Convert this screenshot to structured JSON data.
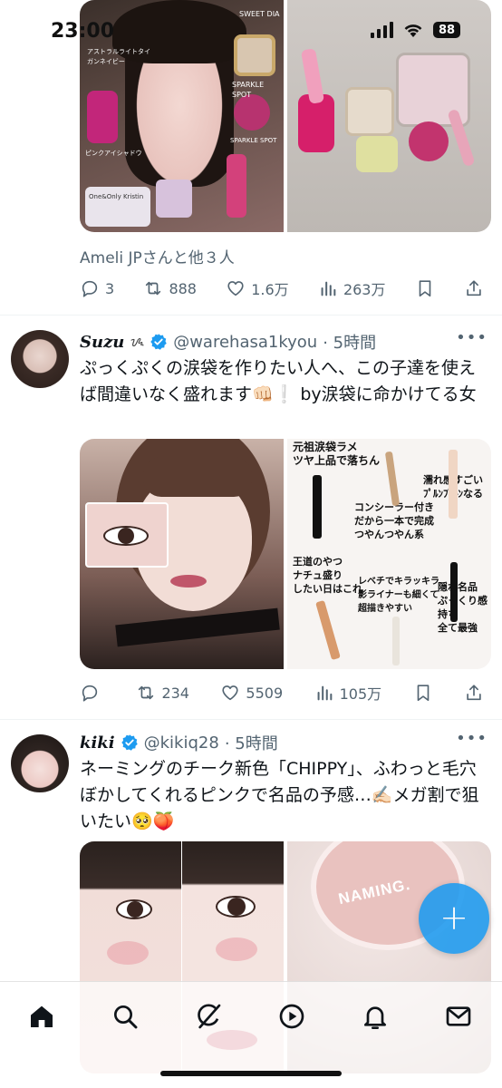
{
  "status_bar": {
    "time": "23:00",
    "battery": "88"
  },
  "tweet1": {
    "social_context": "Ameli JPさんと他３人",
    "image_left_overlays": {
      "label1": "SWEET DIA",
      "label2": "SPARKLE SPOT",
      "label3": "アストラルライトタイガンネイビー",
      "label4": "ピンクアイシャドウ",
      "label5": "One&Only Kristin",
      "label6": "SPARKLE SPOT"
    },
    "replies": "3",
    "reposts": "888",
    "likes": "1.6万",
    "views": "263万"
  },
  "tweet2": {
    "display_name": "Suzu",
    "handle": "@warehasa1kyou",
    "time": "· 5時間",
    "text": "ぷっくぷくの涙袋を作りたい人へ、この子達を使えば間違いなく盛れます👊🏻❕ by涙袋に命かけてる女",
    "overlays": {
      "p1": "元祖涙袋ラメ\nツヤ上品で落ちん",
      "p2": "コンシーラー付き\nだから一本で完成\nつやんつやん系",
      "p3": "濡れ感すごい\nﾌﾟﾙﾝﾌﾟﾙﾝなる",
      "p4": "王道のやつ\nナチュ盛り\nしたい日はこれ",
      "p5": "レベチでキラッキラ\n影ライナーも細くて\n超描きやすい",
      "p6": "隠れ名品\nぷっくり感\n持ち\n全て最強"
    },
    "replies": "",
    "reposts": "234",
    "likes": "5509",
    "views": "105万"
  },
  "tweet3": {
    "display_name": "kiki",
    "handle": "@kikiq28",
    "time": "· 5時間",
    "text": "ネーミングのチーク新色「CHIPPY」、ふわっと毛穴ぼかしてくれるピンクで名品の予感…✍🏻メガ割で狙いたい🥺🍑",
    "image_right_brand": "NAMING."
  },
  "colors": {
    "accent": "#1d9bf0",
    "text": "#0f1419",
    "secondary": "#536471",
    "divider": "#eff3f4"
  },
  "icons": {
    "reply": "reply-icon",
    "repost": "repost-icon",
    "like": "heart-icon",
    "views": "views-icon",
    "bookmark": "bookmark-icon",
    "share": "share-icon",
    "verified": "verified-badge-icon",
    "compose": "plus-icon",
    "tabs": [
      "home-icon",
      "search-icon",
      "grok-icon",
      "video-icon",
      "bell-icon",
      "mail-icon"
    ]
  }
}
